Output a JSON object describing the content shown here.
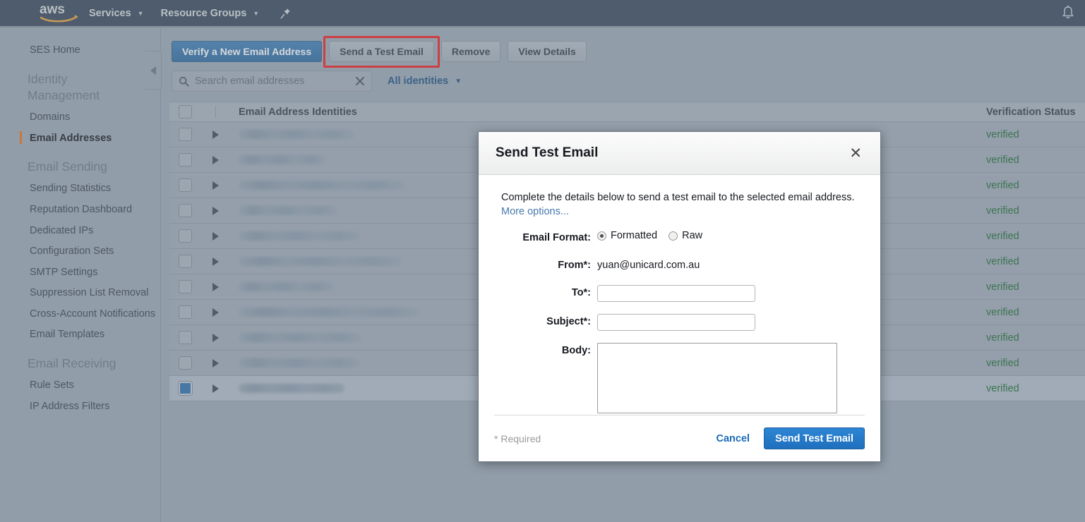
{
  "topnav": {
    "logo_alt": "aws",
    "items": [
      {
        "label": "Services",
        "icon": "chevron-down-icon"
      },
      {
        "label": "Resource Groups",
        "icon": "chevron-down-icon"
      }
    ],
    "pin_icon": "pin-icon",
    "bell_icon": "bell-icon"
  },
  "sidebar": {
    "home": {
      "label": "SES Home"
    },
    "groups": [
      {
        "title": "Identity Management",
        "items": [
          {
            "label": "Domains",
            "active": false
          },
          {
            "label": "Email Addresses",
            "active": true
          }
        ]
      },
      {
        "title": "Email Sending",
        "items": [
          {
            "label": "Sending Statistics",
            "active": false
          },
          {
            "label": "Reputation Dashboard",
            "active": false
          },
          {
            "label": "Dedicated IPs",
            "active": false
          },
          {
            "label": "Configuration Sets",
            "active": false
          },
          {
            "label": "SMTP Settings",
            "active": false
          },
          {
            "label": "Suppression List Removal",
            "active": false
          },
          {
            "label": "Cross-Account Notifications",
            "active": false
          },
          {
            "label": "Email Templates",
            "active": false
          }
        ]
      },
      {
        "title": "Email Receiving",
        "items": [
          {
            "label": "Rule Sets",
            "active": false
          },
          {
            "label": "IP Address Filters",
            "active": false
          }
        ]
      }
    ],
    "collapse_icon": "chevron-left-icon"
  },
  "toolbar": {
    "verify_label": "Verify a New Email Address",
    "send_test_label": "Send a Test Email",
    "remove_label": "Remove",
    "view_details_label": "View Details",
    "highlight_color": "#f31c1c"
  },
  "search": {
    "placeholder": "Search email addresses",
    "value": "",
    "search_icon": "search-icon",
    "clear_icon": "close-icon",
    "filter_label": "All identities",
    "filter_icon": "chevron-down-icon"
  },
  "table": {
    "columns": [
      "Email Address Identities",
      "Verification Status"
    ],
    "rows": [
      {
        "email": "",
        "status": "verified",
        "selected": false,
        "redact_width": 165
      },
      {
        "email": "",
        "status": "verified",
        "selected": false,
        "redact_width": 125
      },
      {
        "email": "",
        "status": "verified",
        "selected": false,
        "redact_width": 238
      },
      {
        "email": "",
        "status": "verified",
        "selected": false,
        "redact_width": 140
      },
      {
        "email": "",
        "status": "verified",
        "selected": false,
        "redact_width": 172
      },
      {
        "email": "",
        "status": "verified",
        "selected": false,
        "redact_width": 232
      },
      {
        "email": "",
        "status": "verified",
        "selected": false,
        "redact_width": 135
      },
      {
        "email": "",
        "status": "verified",
        "selected": false,
        "redact_width": 257
      },
      {
        "email": "",
        "status": "verified",
        "selected": false,
        "redact_width": 175
      },
      {
        "email": "",
        "status": "verified",
        "selected": false,
        "redact_width": 172
      },
      {
        "email": "",
        "status": "verified",
        "selected": true,
        "redact_width": 150
      }
    ],
    "status_color": "#1d6b31"
  },
  "modal": {
    "title": "Send Test Email",
    "close_icon": "close-icon",
    "description": "Complete the details below to send a test email to the selected email address.",
    "more_options_label": "More options...",
    "fields": {
      "format_label": "Email Format:",
      "format_options": [
        {
          "label": "Formatted",
          "selected": true
        },
        {
          "label": "Raw",
          "selected": false
        }
      ],
      "from_label": "From*:",
      "from_value": "yuan@unicard.com.au",
      "to_label": "To*:",
      "to_value": "",
      "subject_label": "Subject*:",
      "subject_value": "",
      "body_label": "Body:",
      "body_value": ""
    },
    "required_note": "* Required",
    "cancel_label": "Cancel",
    "submit_label": "Send Test Email",
    "submit_color": "#1f6fbd"
  }
}
